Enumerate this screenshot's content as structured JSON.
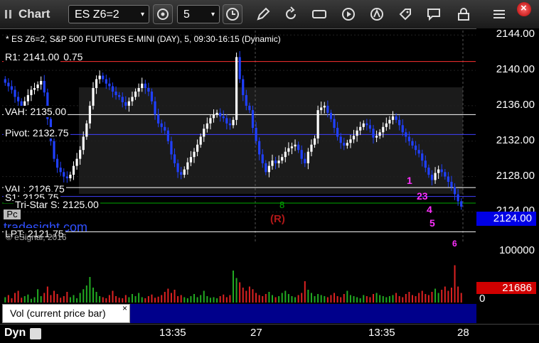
{
  "toolbar": {
    "title": "Chart",
    "symbol": "ES Z6=2",
    "interval": "5"
  },
  "chart": {
    "header": "* ES Z6=2, S&P 500 FUTURES E-MINI (DAY), 5, 09:30-16:15 (Dynamic)",
    "watermark": "tradesight.com",
    "copyright": "© eSignal, 2016",
    "price_tag": "2124.00",
    "volume_tag": "21686",
    "levels": [
      {
        "label": "R1: 2141.00",
        "extra": "0.75",
        "price": 2141.0,
        "color": "#ff3030"
      },
      {
        "label": "VAH: 2135.00",
        "price": 2135.0,
        "color": "#ffffff"
      },
      {
        "label": "Pivot: 2132.75",
        "price": 2132.75,
        "color": "#4040ff"
      },
      {
        "label": "VAL: 2126.75",
        "price": 2126.75,
        "color": "#ffffff"
      },
      {
        "label": "S1: 2125.75",
        "price": 2125.75,
        "color": "#4040ff"
      },
      {
        "label": "Tri-Star S: 2125.00",
        "price": 2125.0,
        "color": "#00aa00"
      },
      {
        "label": "LPT: 2121.75",
        "price": 2121.75,
        "color": "#ffffff"
      }
    ],
    "pc_label": "Pc",
    "r_marker": "(R)",
    "magenta_markers": [
      "1",
      "23",
      "4",
      "5",
      "6"
    ],
    "green_marker": "8"
  },
  "chart_data": {
    "type": "candlestick",
    "y_ticks": [
      "2144.00",
      "2140.00",
      "2136.00",
      "2132.00",
      "2128.00",
      "2124.00"
    ],
    "ylim": [
      2120.5,
      2144.5
    ],
    "volume_ticks": [
      "100000",
      "0"
    ],
    "x_ticks": [
      "13:35",
      "27",
      "13:35",
      "28"
    ],
    "series": [
      {
        "name": "price",
        "values": [
          2138.6,
          2138.2,
          2137.8,
          2137.0,
          2136.5,
          2136.0,
          2136.5,
          2137.2,
          2137.8,
          2138.0,
          2138.4,
          2138.8,
          2137.5,
          2134.5,
          2132.0,
          2130.0,
          2129.0,
          2128.5,
          2128.0,
          2127.8,
          2128.2,
          2129.2,
          2130.0,
          2131.0,
          2132.5,
          2134.0,
          2136.0,
          2138.0,
          2139.0,
          2139.4,
          2139.0,
          2138.5,
          2138.2,
          2137.6,
          2137.2,
          2137.0,
          2136.4,
          2136.0,
          2136.5,
          2137.0,
          2137.6,
          2138.0,
          2138.5,
          2138.0,
          2137.6,
          2136.5,
          2135.0,
          2134.0,
          2133.6,
          2133.2,
          2132.0,
          2130.5,
          2129.5,
          2128.5,
          2128.2,
          2128.8,
          2129.6,
          2130.2,
          2130.8,
          2131.6,
          2132.5,
          2133.4,
          2134.0,
          2134.6,
          2135.0,
          2135.2,
          2134.8,
          2134.6,
          2134.0,
          2133.8,
          2134.4,
          2141.5,
          2139.0,
          2137.2,
          2136.0,
          2135.5,
          2133.5,
          2132.0,
          2130.5,
          2129.5,
          2128.5,
          2129.2,
          2129.8,
          2129.5,
          2129.8,
          2130.2,
          2130.8,
          2131.2,
          2131.4,
          2131.6,
          2131.0,
          2130.0,
          2129.5,
          2130.8,
          2131.6,
          2132.3,
          2135.5,
          2135.8,
          2136.0,
          2135.2,
          2134.5,
          2133.5,
          2132.5,
          2131.8,
          2131.5,
          2131.8,
          2132.2,
          2132.6,
          2133.2,
          2133.6,
          2134.0,
          2133.8,
          2133.4,
          2132.4,
          2132.6,
          2133.0,
          2133.6,
          2134.0,
          2134.4,
          2134.8,
          2134.4,
          2133.8,
          2133.0,
          2132.5,
          2132.0,
          2131.5,
          2131.0,
          2130.6,
          2129.8,
          2129.0,
          2128.2,
          2127.6,
          2128.4,
          2128.8,
          2128.5,
          2128.0,
          2127.4,
          2126.8,
          2126.0,
          2125.2,
          2124.6
        ]
      }
    ],
    "volume": [
      10,
      14,
      8,
      18,
      22,
      9,
      12,
      15,
      7,
      10,
      25,
      12,
      18,
      30,
      14,
      22,
      16,
      9,
      12,
      20,
      10,
      14,
      8,
      18,
      25,
      32,
      48,
      28,
      20,
      12,
      10,
      8,
      14,
      22,
      12,
      9,
      8,
      14,
      10,
      16,
      12,
      18,
      10,
      8,
      12,
      15,
      9,
      11,
      14,
      20,
      26,
      18,
      24,
      12,
      14,
      10,
      8,
      12,
      16,
      10,
      14,
      22,
      12,
      9,
      10,
      8,
      12,
      15,
      10,
      14,
      60,
      46,
      38,
      28,
      22,
      30,
      25,
      18,
      14,
      12,
      16,
      20,
      14,
      10,
      12,
      18,
      22,
      16,
      12,
      10,
      14,
      18,
      40,
      24,
      18,
      12,
      16,
      14,
      12,
      10,
      14,
      18,
      12,
      10,
      16,
      22,
      14,
      12,
      10,
      8,
      14,
      12,
      10,
      16,
      18,
      14,
      12,
      10,
      12,
      14,
      18,
      12,
      10,
      16,
      20,
      14,
      12,
      18,
      22,
      16,
      14,
      20,
      26,
      18,
      24,
      30,
      22,
      28,
      70,
      30,
      18
    ]
  }
}
